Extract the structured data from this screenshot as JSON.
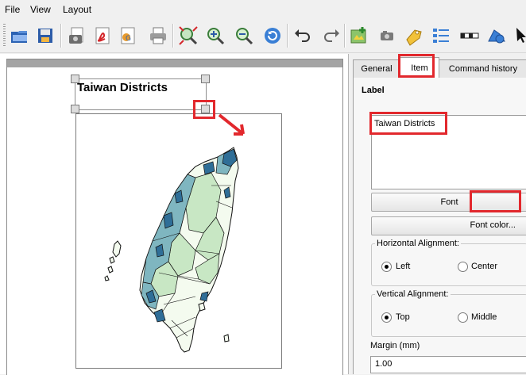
{
  "menu": {
    "file": "File",
    "view": "View",
    "layout": "Layout"
  },
  "toolbar": {
    "icons": [
      "open-folder-icon",
      "save-icon",
      "export-image-icon",
      "export-pdf-icon",
      "export-svg-icon",
      "print-icon",
      "zoom-full-icon",
      "zoom-in-icon",
      "zoom-out-icon",
      "refresh-icon",
      "undo-icon",
      "redo-icon",
      "add-map-icon",
      "add-image-icon",
      "add-label-icon",
      "add-legend-icon",
      "add-scalebar-icon",
      "add-shape-icon",
      "select-arrow-icon"
    ]
  },
  "canvas": {
    "label_text": "Taiwan Districts"
  },
  "panel": {
    "tabs": {
      "general": "General",
      "item": "Item",
      "command_history": "Command history"
    },
    "section_title": "Label",
    "label_value": "Taiwan Districts",
    "font_button": "Font",
    "font_color_button": "Font color...",
    "h_align": {
      "legend": "Horizontal Alignment:",
      "left": "Left",
      "center": "Center",
      "selected": "Left"
    },
    "v_align": {
      "legend": "Vertical Alignment:",
      "top": "Top",
      "middle": "Middle",
      "selected": "Top"
    },
    "margin_label": "Margin (mm)",
    "margin_value": "1.00"
  },
  "colors": {
    "highlight": "#e2282d",
    "map_dark": "#2f6e97",
    "map_mid": "#7fb6c0",
    "map_light": "#c8e7c4",
    "map_pale": "#f4fbef"
  }
}
